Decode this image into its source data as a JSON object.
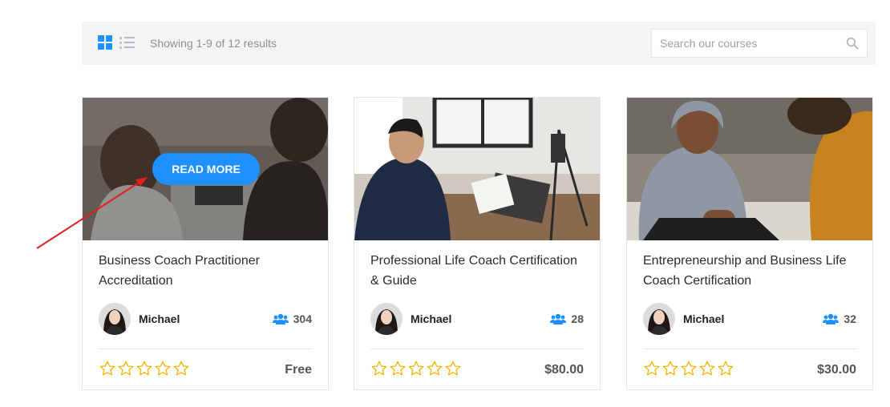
{
  "toolbar": {
    "grid_icon": "grid-view-icon",
    "list_icon": "list-view-icon",
    "result_count": "Showing 1-9 of 12 results",
    "search_placeholder": "Search our courses",
    "search_icon": "search-icon"
  },
  "colors": {
    "accent": "#1e90ff",
    "star": "#f5b301",
    "annotation_arrow": "#e0201b"
  },
  "courses": [
    {
      "title": "Business Coach Practitioner Accreditation",
      "author": "Michael",
      "students": "304",
      "price": "Free",
      "rating": 0,
      "hover_button": "READ MORE"
    },
    {
      "title": "Professional Life Coach Certification & Guide",
      "author": "Michael",
      "students": "28",
      "price": "$80.00",
      "rating": 0
    },
    {
      "title": "Entrepreneurship and Business Life Coach Certification",
      "author": "Michael",
      "students": "32",
      "price": "$30.00",
      "rating": 0
    }
  ]
}
